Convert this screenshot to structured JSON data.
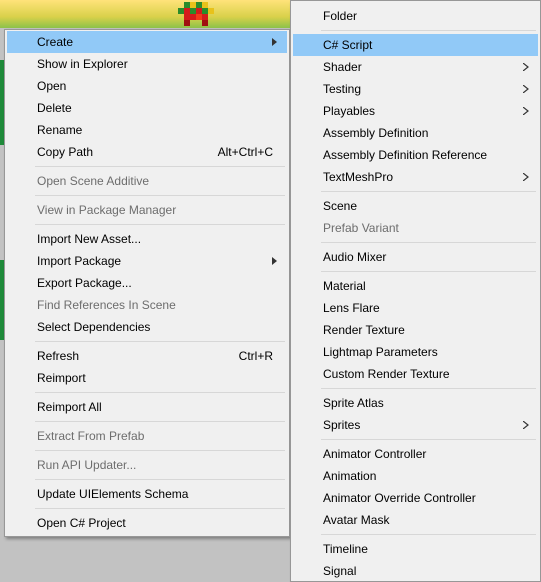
{
  "left_menu": {
    "create": "Create",
    "show_in_explorer": "Show in Explorer",
    "open": "Open",
    "delete": "Delete",
    "rename": "Rename",
    "copy_path": "Copy Path",
    "copy_path_shortcut": "Alt+Ctrl+C",
    "open_scene_additive": "Open Scene Additive",
    "view_in_package_manager": "View in Package Manager",
    "import_new_asset": "Import New Asset...",
    "import_package": "Import Package",
    "export_package": "Export Package...",
    "find_references": "Find References In Scene",
    "select_dependencies": "Select Dependencies",
    "refresh": "Refresh",
    "refresh_shortcut": "Ctrl+R",
    "reimport": "Reimport",
    "reimport_all": "Reimport All",
    "extract_from_prefab": "Extract From Prefab",
    "run_api_updater": "Run API Updater...",
    "update_uielements_schema": "Update UIElements Schema",
    "open_csharp_project": "Open C# Project"
  },
  "create_menu": {
    "folder": "Folder",
    "csharp_script": "C# Script",
    "shader": "Shader",
    "testing": "Testing",
    "playables": "Playables",
    "assembly_definition": "Assembly Definition",
    "assembly_definition_reference": "Assembly Definition Reference",
    "textmeshpro": "TextMeshPro",
    "scene": "Scene",
    "prefab_variant": "Prefab Variant",
    "audio_mixer": "Audio Mixer",
    "material": "Material",
    "lens_flare": "Lens Flare",
    "render_texture": "Render Texture",
    "lightmap_parameters": "Lightmap Parameters",
    "custom_render_texture": "Custom Render Texture",
    "sprite_atlas": "Sprite Atlas",
    "sprites": "Sprites",
    "animator_controller": "Animator Controller",
    "animation": "Animation",
    "animator_override_controller": "Animator Override Controller",
    "avatar_mask": "Avatar Mask",
    "timeline": "Timeline",
    "signal": "Signal"
  },
  "colors": {
    "menu_background": "#f0f0f0",
    "highlight": "#91c9f7",
    "disabled_text": "#6d6d6d",
    "separator": "#d7d7d7"
  }
}
